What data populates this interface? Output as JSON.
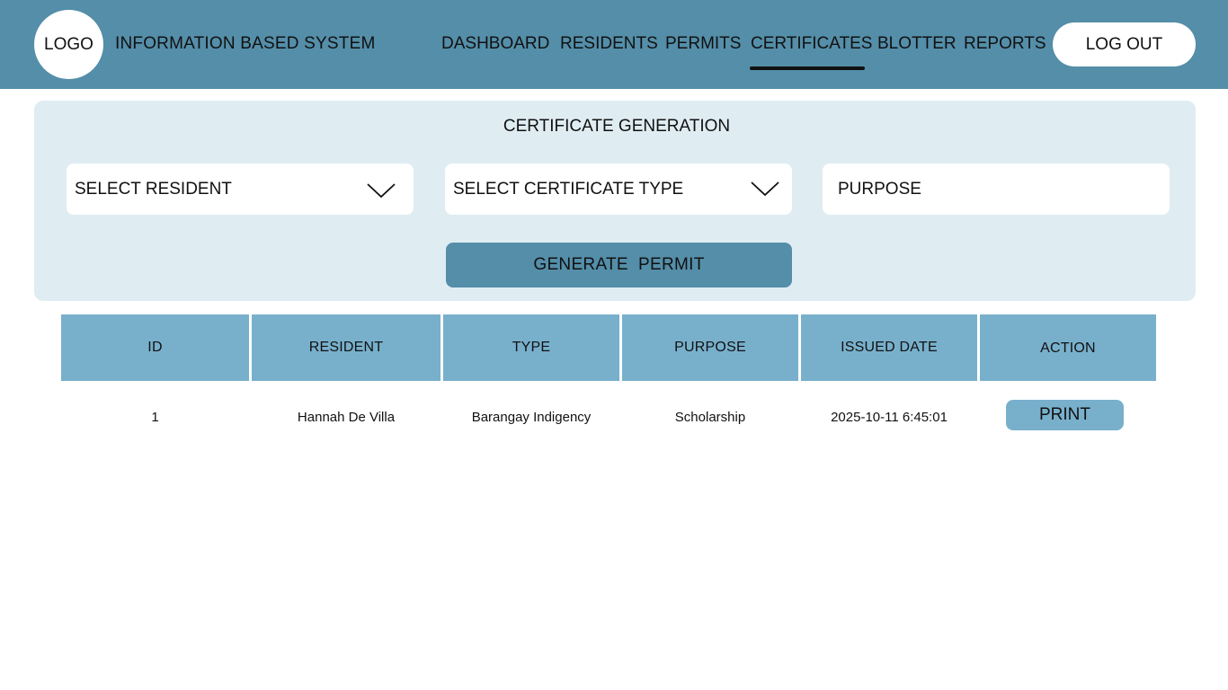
{
  "header": {
    "logo_text": "LOGO",
    "app_title": "INFORMATION BASED SYSTEM",
    "nav": [
      {
        "label": "DASHBOARD"
      },
      {
        "label": "RESIDENTS"
      },
      {
        "label": "PERMITS"
      },
      {
        "label": "CERTIFICATES",
        "active": true
      },
      {
        "label": "BLOTTER"
      },
      {
        "label": "REPORTS"
      }
    ],
    "logout_label": "LOG OUT"
  },
  "form": {
    "title": "CERTIFICATE GENERATION",
    "resident_select": "SELECT RESIDENT",
    "type_select": "SELECT CERTIFICATE TYPE",
    "purpose_placeholder": "PURPOSE",
    "generate_label": "GENERATE  PERMIT"
  },
  "table": {
    "columns": [
      "ID",
      "RESIDENT",
      "TYPE",
      "PURPOSE",
      "ISSUED DATE",
      "ACTION"
    ],
    "rows": [
      {
        "id": "1",
        "resident": "Hannah De Villa",
        "type": "Barangay Indigency",
        "purpose": "Scholarship",
        "issued_date": "2025-10-11 6:45:01",
        "action": "PRINT"
      }
    ]
  },
  "colors": {
    "header_bg": "#548ea9",
    "panel_bg": "#dfedf3",
    "table_header_bg": "#78b0cc",
    "button_bg": "#548ea9"
  }
}
